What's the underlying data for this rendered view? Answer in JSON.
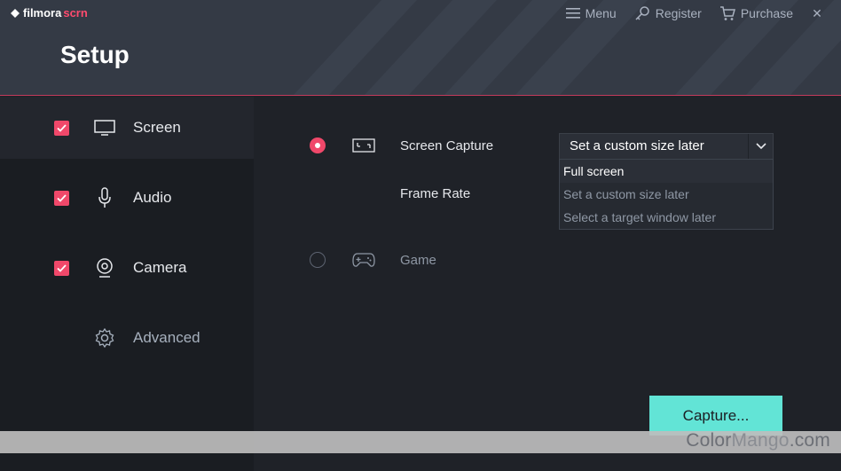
{
  "app": {
    "logo_text": "filmora",
    "logo_accent": "scrn",
    "title": "Setup"
  },
  "topnav": {
    "menu_label": "Menu",
    "register_label": "Register",
    "purchase_label": "Purchase",
    "close_glyph": "✕"
  },
  "sidebar": {
    "items": [
      {
        "label": "Screen",
        "icon": "monitor-icon",
        "checked": true
      },
      {
        "label": "Audio",
        "icon": "microphone-icon",
        "checked": true
      },
      {
        "label": "Camera",
        "icon": "webcam-icon",
        "checked": true
      },
      {
        "label": "Advanced",
        "icon": "gear-icon",
        "checked": false
      }
    ]
  },
  "main": {
    "screen_capture_label": "Screen Capture",
    "frame_rate_label": "Frame Rate",
    "game_label": "Game",
    "capture_select": {
      "value": "Set a custom size later",
      "options": [
        "Full screen",
        "Set a custom size later",
        "Select a target window later"
      ]
    },
    "capture_button": "Capture..."
  },
  "watermark": {
    "part1": "Color",
    "part2": "Mango",
    "part3": ".com"
  },
  "colors": {
    "accent_pink": "#f0486a",
    "capture_teal": "#62e4d6",
    "header_bg": "#343a45"
  }
}
